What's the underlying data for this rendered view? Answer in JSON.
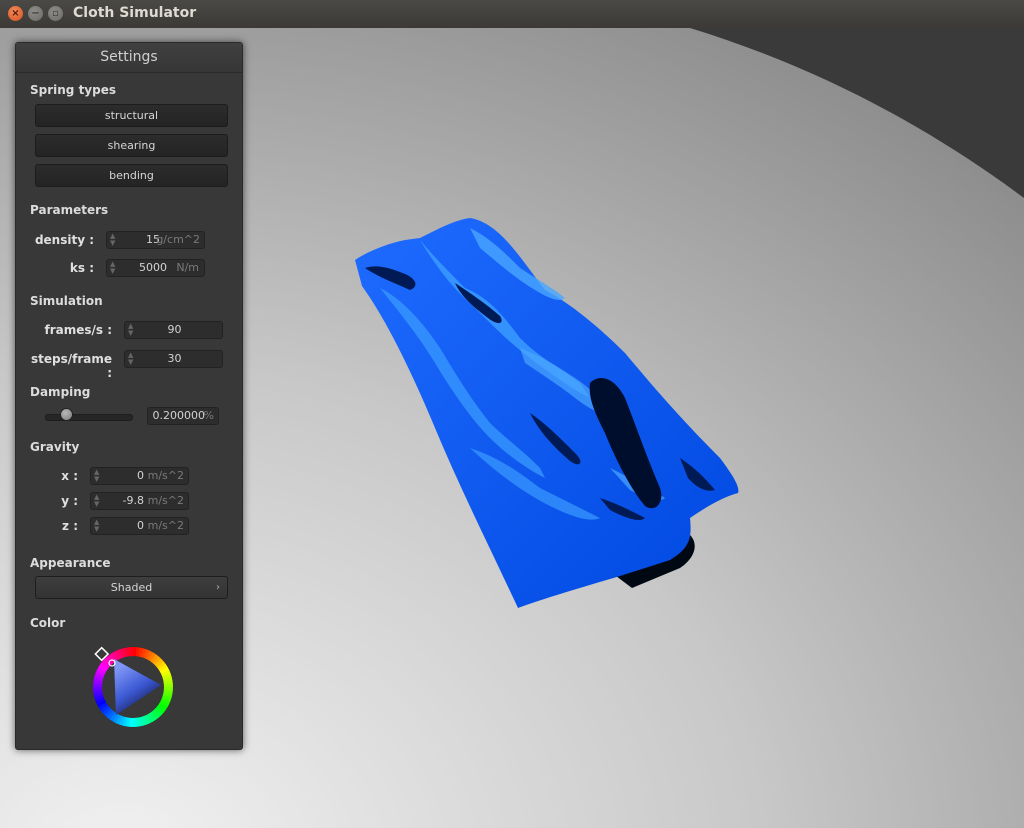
{
  "window": {
    "title": "Cloth Simulator",
    "close_glyph": "×",
    "minimize_glyph": "−",
    "maximize_glyph": "▫"
  },
  "panel": {
    "title": "Settings",
    "spring_types": {
      "label": "Spring types",
      "buttons": [
        "structural",
        "shearing",
        "bending"
      ]
    },
    "parameters": {
      "label": "Parameters",
      "density": {
        "label": "density :",
        "value": "15",
        "unit": "g/cm^2"
      },
      "ks": {
        "label": "ks :",
        "value": "5000",
        "unit": "N/m"
      }
    },
    "simulation": {
      "label": "Simulation",
      "frames": {
        "label": "frames/s :",
        "value": "90"
      },
      "steps": {
        "label": "steps/frame :",
        "value": "30"
      }
    },
    "damping": {
      "label": "Damping",
      "value": "0.200000",
      "unit": "%",
      "slider_fraction": 0.2
    },
    "gravity": {
      "label": "Gravity",
      "x": {
        "label": "x :",
        "value": "0",
        "unit": "m/s^2"
      },
      "y": {
        "label": "y :",
        "value": "-9.8",
        "unit": "m/s^2"
      },
      "z": {
        "label": "z :",
        "value": "0",
        "unit": "m/s^2"
      }
    },
    "appearance": {
      "label": "Appearance",
      "selected": "Shaded",
      "chevron": "›"
    },
    "color": {
      "label": "Color",
      "value": "#0055ff"
    }
  },
  "colors": {
    "cloth": "#0055ff",
    "cloth_light": "#2f8cff",
    "cloth_dark": "#001a55"
  }
}
